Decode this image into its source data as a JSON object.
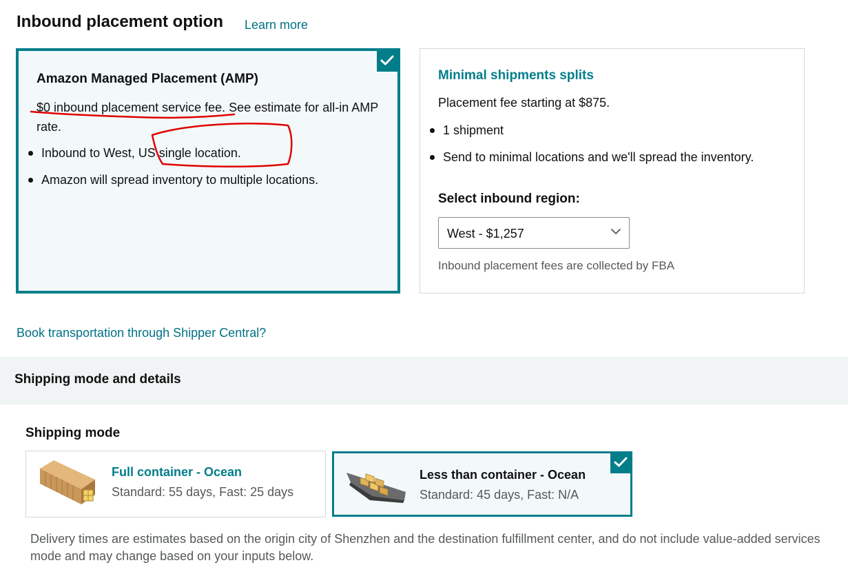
{
  "header": {
    "title": "Inbound placement option",
    "learn_more": "Learn more"
  },
  "placement_options": {
    "amp": {
      "title": "Amazon Managed Placement (AMP)",
      "description": "$0 inbound placement service fee. See estimate for all-in AMP rate.",
      "bullets": [
        "Inbound to West, US single location.",
        "Amazon will spread inventory to multiple locations."
      ],
      "selected": true
    },
    "minimal": {
      "title": "Minimal shipments splits",
      "subtitle": "Placement fee starting at $875.",
      "bullets": [
        "1 shipment",
        "Send to minimal locations and we'll spread the inventory."
      ],
      "region_label": "Select inbound region:",
      "region_value": "West - $1,257",
      "fees_note": "Inbound placement fees are collected by FBA",
      "selected": false
    }
  },
  "book_link": "Book transportation through Shipper Central?",
  "shipping_section": {
    "title": "Shipping mode and details",
    "mode_label": "Shipping mode",
    "modes": [
      {
        "title": "Full container - Ocean",
        "subtitle": "Standard: 55 days, Fast: 25 days",
        "icon": "shipping-container-icon",
        "selected": false
      },
      {
        "title": "Less than container - Ocean",
        "subtitle": "Standard: 45 days, Fast: N/A",
        "icon": "cargo-ship-icon",
        "selected": true
      }
    ],
    "disclaimer_line1": "Delivery times are estimates based on the origin city of Shenzhen and the destination fulfillment center, and do not include value-added services",
    "disclaimer_line2": "mode and may change based on your inputs below."
  },
  "colors": {
    "teal": "#017e8a",
    "link": "#007185",
    "annotation": "#e00000"
  }
}
